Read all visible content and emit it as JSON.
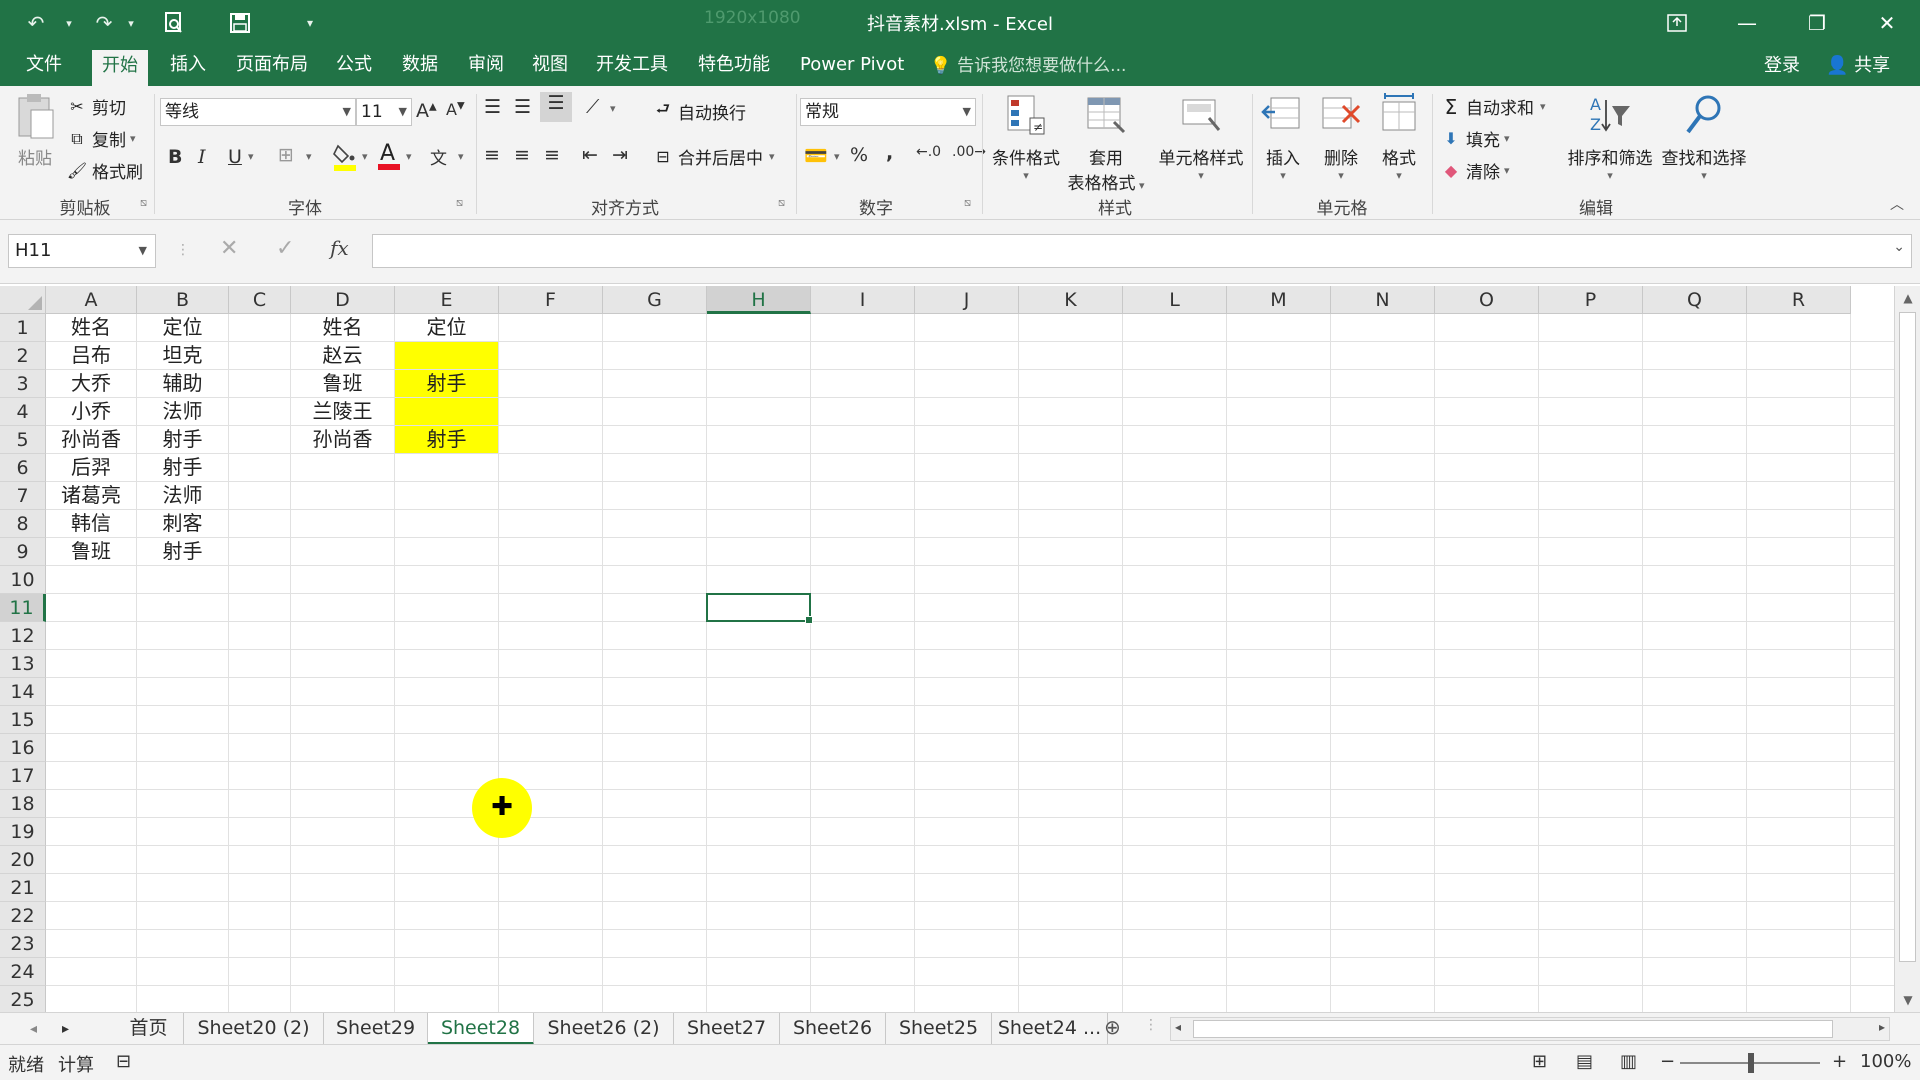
{
  "window": {
    "title": "抖音素材.xlsm - Excel",
    "ghost_text": "1920x1080"
  },
  "menu": {
    "tabs": [
      "文件",
      "开始",
      "插入",
      "页面布局",
      "公式",
      "数据",
      "审阅",
      "视图",
      "开发工具",
      "特色功能",
      "Power Pivot"
    ],
    "active": "开始",
    "tell_me": "告诉我您想要做什么...",
    "login": "登录",
    "share": "共享"
  },
  "ribbon": {
    "clipboard": {
      "label": "剪贴板",
      "paste": "粘贴",
      "cut": "剪切",
      "copy": "复制",
      "format_painter": "格式刷"
    },
    "font": {
      "label": "字体",
      "name": "等线",
      "size": "11"
    },
    "alignment": {
      "label": "对齐方式",
      "wrap": "自动换行",
      "merge": "合并后居中"
    },
    "number": {
      "label": "数字",
      "format": "常规"
    },
    "styles": {
      "label": "样式",
      "conditional": "条件格式",
      "table_line1": "套用",
      "table_line2": "表格格式",
      "cell_styles": "单元格样式"
    },
    "cells": {
      "label": "单元格",
      "insert": "插入",
      "delete": "删除",
      "format": "格式"
    },
    "editing": {
      "label": "编辑",
      "autosum": "自动求和",
      "fill": "填充",
      "clear": "清除",
      "sort": "排序和筛选",
      "find": "查找和选择"
    }
  },
  "formula_bar": {
    "name_box": "H11",
    "fx": "fx",
    "content": ""
  },
  "sheet": {
    "columns": [
      "A",
      "B",
      "C",
      "D",
      "E",
      "F",
      "G",
      "H",
      "I",
      "J",
      "K",
      "L",
      "M",
      "N",
      "O",
      "P",
      "Q",
      "R"
    ],
    "rows": [
      "1",
      "2",
      "3",
      "4",
      "5",
      "6",
      "7",
      "8",
      "9",
      "10",
      "11",
      "12",
      "13",
      "14",
      "15",
      "16",
      "17",
      "18",
      "19",
      "20",
      "21",
      "22",
      "23",
      "24",
      "25"
    ],
    "selected_col": "H",
    "selected_row": "11",
    "cells": {
      "A1": "姓名",
      "B1": "定位",
      "D1": "姓名",
      "E1": "定位",
      "A2": "吕布",
      "B2": "坦克",
      "D2": "赵云",
      "A3": "大乔",
      "B3": "辅助",
      "D3": "鲁班",
      "E3": "射手",
      "A4": "小乔",
      "B4": "法师",
      "D4": "兰陵王",
      "A5": "孙尚香",
      "B5": "射手",
      "D5": "孙尚香",
      "E5": "射手",
      "A6": "后羿",
      "B6": "射手",
      "A7": "诸葛亮",
      "B7": "法师",
      "A8": "韩信",
      "B8": "刺客",
      "A9": "鲁班",
      "B9": "射手"
    },
    "highlight_color": "#ffff00",
    "highlighted_cells": [
      "E2",
      "E3",
      "E4",
      "E5"
    ]
  },
  "sheet_tabs": {
    "tabs": [
      "首页",
      "Sheet20 (2)",
      "Sheet29",
      "Sheet28",
      "Sheet26 (2)",
      "Sheet27",
      "Sheet26",
      "Sheet25",
      "Sheet24 ..."
    ],
    "active": "Sheet28"
  },
  "status": {
    "ready": "就绪",
    "calc": "计算",
    "zoom": "100%"
  },
  "colors": {
    "excel_green": "#217346",
    "ribbon_bg": "#f3f3f3",
    "highlight_yellow": "#ffff00"
  }
}
